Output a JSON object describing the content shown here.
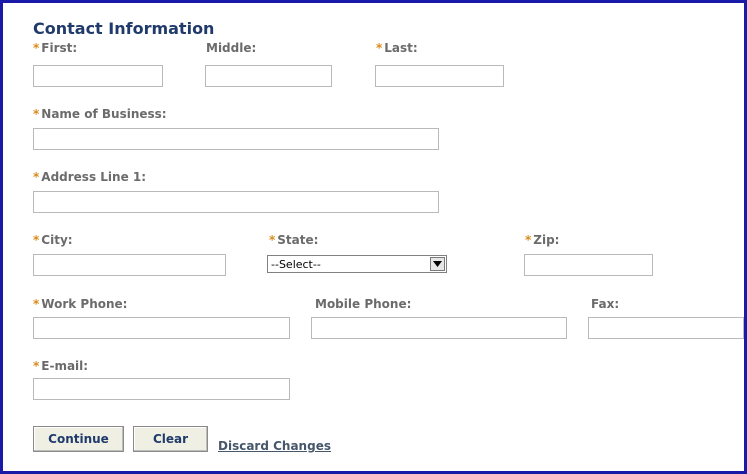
{
  "form": {
    "title": "Contact Information",
    "required_marker": "*",
    "labels": {
      "first": "First:",
      "middle": "Middle:",
      "last": "Last:",
      "business": "Name of Business:",
      "address1": "Address Line 1:",
      "city": "City:",
      "state": "State:",
      "zip": "Zip:",
      "work_phone": "Work Phone:",
      "mobile_phone": "Mobile Phone:",
      "fax": "Fax:",
      "email": "E-mail:"
    },
    "state_select": {
      "value": "--Select--"
    },
    "buttons": {
      "continue": "Continue",
      "clear": "Clear",
      "discard": "Discard Changes"
    }
  },
  "colors": {
    "border": "#1a1aa8",
    "title": "#1f3a6b",
    "label": "#6b6b6b",
    "required": "#d98a1b"
  }
}
